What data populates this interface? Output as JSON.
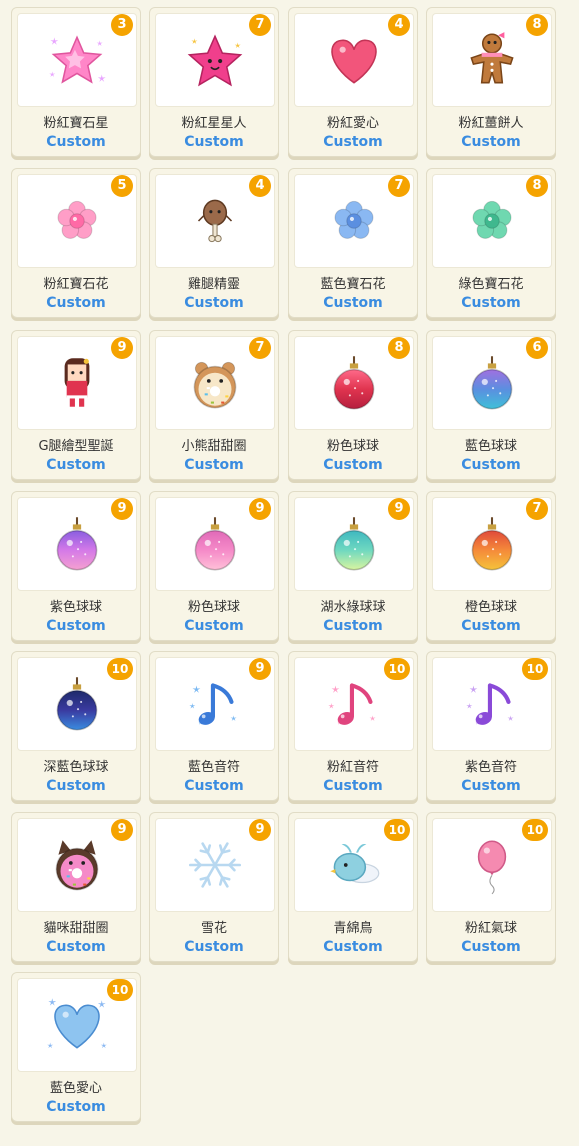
{
  "items": [
    {
      "name": "粉紅寶石星",
      "tag": "Custom",
      "badge": "3",
      "icon": "pink-gem-star-icon"
    },
    {
      "name": "粉紅星星人",
      "tag": "Custom",
      "badge": "7",
      "icon": "pink-star-character-icon"
    },
    {
      "name": "粉紅愛心",
      "tag": "Custom",
      "badge": "4",
      "icon": "pink-heart-icon"
    },
    {
      "name": "粉紅薑餅人",
      "tag": "Custom",
      "badge": "8",
      "icon": "gingerbread-man-icon"
    },
    {
      "name": "粉紅寶石花",
      "tag": "Custom",
      "badge": "5",
      "icon": "pink-gem-flower-icon"
    },
    {
      "name": "雞腿精靈",
      "tag": "Custom",
      "badge": "4",
      "icon": "drumstick-sprite-icon"
    },
    {
      "name": "藍色寶石花",
      "tag": "Custom",
      "badge": "7",
      "icon": "blue-gem-flower-icon"
    },
    {
      "name": "綠色寶石花",
      "tag": "Custom",
      "badge": "8",
      "icon": "green-gem-flower-icon"
    },
    {
      "name": "G腿繪型聖誕",
      "tag": "Custom",
      "badge": "9",
      "icon": "christmas-girl-icon"
    },
    {
      "name": "小熊甜甜圈",
      "tag": "Custom",
      "badge": "7",
      "icon": "bear-donut-icon"
    },
    {
      "name": "粉色球球",
      "tag": "Custom",
      "badge": "8",
      "icon": "pink-red-ornament-icon"
    },
    {
      "name": "藍色球球",
      "tag": "Custom",
      "badge": "6",
      "icon": "blue-ornament-icon"
    },
    {
      "name": "紫色球球",
      "tag": "Custom",
      "badge": "9",
      "icon": "purple-ornament-icon"
    },
    {
      "name": "粉色球球",
      "tag": "Custom",
      "badge": "9",
      "icon": "pink-ornament-icon"
    },
    {
      "name": "湖水綠球球",
      "tag": "Custom",
      "badge": "9",
      "icon": "aqua-ornament-icon"
    },
    {
      "name": "橙色球球",
      "tag": "Custom",
      "badge": "7",
      "icon": "orange-ornament-icon"
    },
    {
      "name": "深藍色球球",
      "tag": "Custom",
      "badge": "10",
      "icon": "dark-blue-ornament-icon"
    },
    {
      "name": "藍色音符",
      "tag": "Custom",
      "badge": "9",
      "icon": "blue-music-note-icon"
    },
    {
      "name": "粉紅音符",
      "tag": "Custom",
      "badge": "10",
      "icon": "pink-music-note-icon"
    },
    {
      "name": "紫色音符",
      "tag": "Custom",
      "badge": "10",
      "icon": "purple-music-note-icon"
    },
    {
      "name": "貓咪甜甜圈",
      "tag": "Custom",
      "badge": "9",
      "icon": "cat-donut-icon"
    },
    {
      "name": "雪花",
      "tag": "Custom",
      "badge": "9",
      "icon": "snowflake-icon"
    },
    {
      "name": "青綿鳥",
      "tag": "Custom",
      "badge": "10",
      "icon": "cloud-bird-icon"
    },
    {
      "name": "粉紅氣球",
      "tag": "Custom",
      "badge": "10",
      "icon": "pink-balloon-icon"
    },
    {
      "name": "藍色愛心",
      "tag": "Custom",
      "badge": "10",
      "icon": "blue-heart-icon"
    }
  ],
  "colors": {
    "badge": "#f5a300",
    "tag": "#3a8ce0",
    "background": "#f7f5e8"
  }
}
